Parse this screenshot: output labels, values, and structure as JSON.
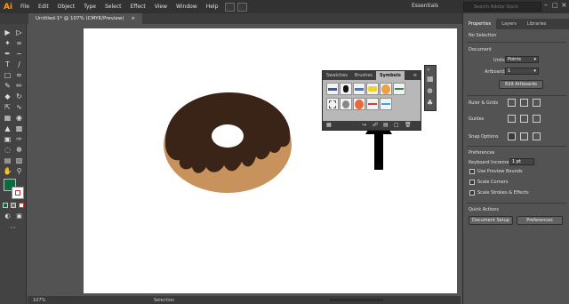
{
  "app": {
    "logo": "Ai"
  },
  "menu": [
    "File",
    "Edit",
    "Object",
    "Type",
    "Select",
    "Effect",
    "View",
    "Window",
    "Help"
  ],
  "workspace": "Essentials",
  "search": {
    "placeholder": "Search Adobe Stock"
  },
  "document": {
    "tab_title": "Untitled-1* @ 107% (CMYK/Preview)",
    "close": "×"
  },
  "status": {
    "zoom": "107%",
    "tool": "Selection"
  },
  "colors": {
    "fill": "#0b6b3e",
    "stroke": "#ffffff",
    "donut_dough": "#c8925c",
    "donut_icing": "#3a2417",
    "arrow": "#000000"
  },
  "symbols_panel": {
    "tabs": [
      "Swatches",
      "Brushes",
      "Symbols"
    ],
    "active_tab": "Symbols",
    "menu": "≡",
    "collapse": "»"
  },
  "properties": {
    "tabs": [
      "Properties",
      "Layers",
      "Libraries"
    ],
    "selection": "No Selection",
    "document_heading": "Document",
    "units_label": "Units:",
    "units_value": "Points",
    "artboard_label": "Artboard:",
    "artboard_value": "1",
    "edit_artboards": "Edit Artboards",
    "ruler_grids": "Ruler & Grids",
    "guides": "Guides",
    "snap_options": "Snap Options",
    "preferences_heading": "Preferences",
    "keyboard_increment_label": "Keyboard Increment:",
    "keyboard_increment_value": "1 pt",
    "use_preview_bounds": "Use Preview Bounds",
    "scale_corners": "Scale Corners",
    "scale_strokes": "Scale Strokes & Effects",
    "quick_actions": "Quick Actions",
    "document_setup": "Document Setup",
    "preferences_button": "Preferences"
  }
}
